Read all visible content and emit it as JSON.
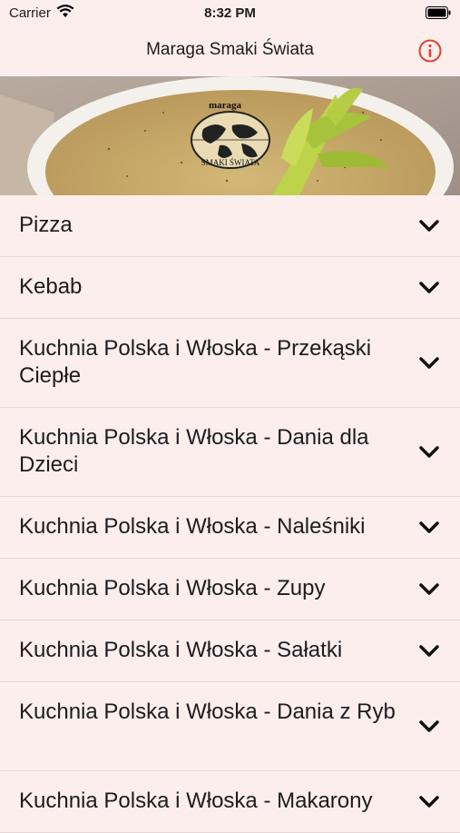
{
  "status": {
    "carrier": "Carrier",
    "time": "8:32 PM"
  },
  "navbar": {
    "title": "Maraga Smaki Świata",
    "info_icon": "info-circle-icon"
  },
  "banner": {
    "logo_top": "maraga",
    "logo_bottom": "SMAKI ŚWIATA"
  },
  "categories": [
    "Pizza",
    "Kebab",
    "Kuchnia Polska i Włoska - Przekąski Ciepłe",
    "Kuchnia Polska i Włoska - Dania dla Dzieci",
    "Kuchnia Polska i Włoska - Naleśniki",
    "Kuchnia Polska i Włoska - Zupy",
    "Kuchnia Polska i Włoska - Sałatki",
    "Kuchnia Polska i Włoska - Dania z Ryb",
    "Kuchnia Polska i Włoska - Makarony"
  ],
  "colors": {
    "accent": "#e0412f",
    "background": "#fdeeee"
  }
}
